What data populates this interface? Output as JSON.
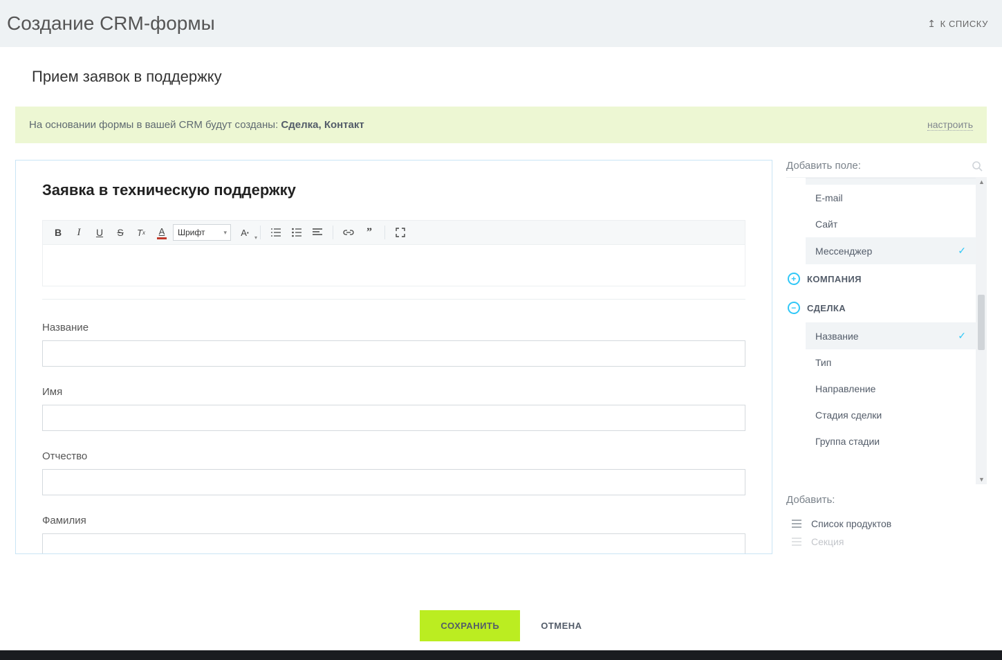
{
  "header": {
    "title": "Создание CRM-формы",
    "back_link": "К СПИСКУ"
  },
  "form": {
    "name": "Прием заявок в поддержку",
    "heading": "Заявка в техническую поддержку"
  },
  "banner": {
    "prefix": "На основании формы в вашей CRM будут созданы: ",
    "entities": "Сделка, Контакт",
    "configure": "настроить"
  },
  "toolbar": {
    "font_value": "Шрифт"
  },
  "fields": [
    {
      "label": "Название"
    },
    {
      "label": "Имя"
    },
    {
      "label": "Отчество"
    },
    {
      "label": "Фамилия"
    }
  ],
  "side": {
    "add_field_label": "Добавить поле:",
    "items_top": [
      {
        "label": "E-mail",
        "selected": false
      },
      {
        "label": "Сайт",
        "selected": false
      },
      {
        "label": "Мессенджер",
        "selected": true
      }
    ],
    "group_company": "КОМПАНИЯ",
    "group_deal": "СДЕЛКА",
    "deal_items": [
      {
        "label": "Название",
        "selected": true
      },
      {
        "label": "Тип",
        "selected": false
      },
      {
        "label": "Направление",
        "selected": false
      },
      {
        "label": "Стадия сделки",
        "selected": false
      },
      {
        "label": "Группа стадии",
        "selected": false
      }
    ],
    "add_label": "Добавить:",
    "add_items": [
      {
        "label": "Список продуктов"
      },
      {
        "label": "Секция"
      }
    ]
  },
  "footer": {
    "save": "СОХРАНИТЬ",
    "cancel": "ОТМЕНА"
  }
}
